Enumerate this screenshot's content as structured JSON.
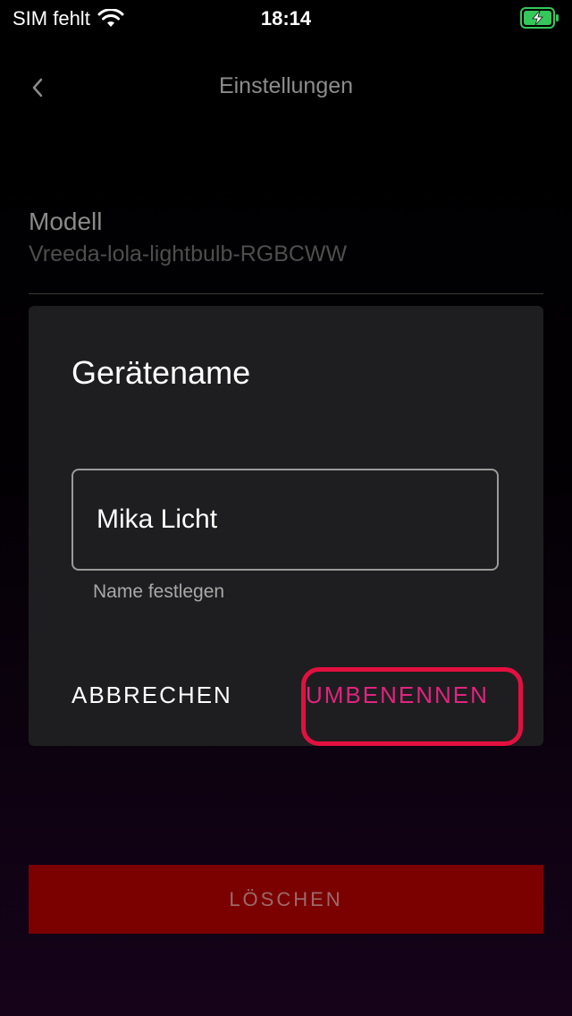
{
  "status_bar": {
    "carrier": "SIM fehlt",
    "time": "18:14"
  },
  "nav": {
    "title": "Einstellungen",
    "back_icon": "chevron-left-icon"
  },
  "model": {
    "label": "Modell",
    "value": "Vreeda-lola-lightbulb-RGBCWW"
  },
  "dialog": {
    "title": "Gerätename",
    "input_value": "Mika Licht",
    "helper": "Name festlegen",
    "cancel_label": "ABBRECHEN",
    "rename_label": "UMBENENNEN"
  },
  "delete_label": "LÖSCHEN",
  "colors": {
    "accent": "#e0247f",
    "highlight": "#e3103f",
    "delete_bg": "#7b0000",
    "battery": "#34c759"
  }
}
